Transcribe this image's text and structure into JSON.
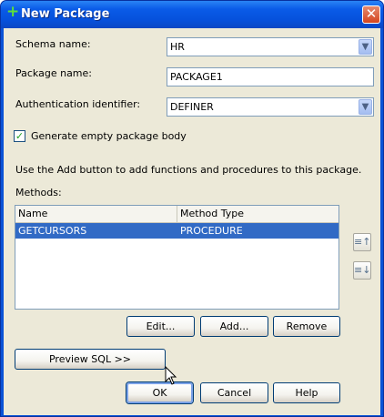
{
  "window": {
    "title": "New Package",
    "close_glyph": "✕"
  },
  "form": {
    "schema_label": "Schema name:",
    "schema_value": "HR",
    "package_label": "Package name:",
    "package_value": "PACKAGE1",
    "auth_label": "Authentication identifier:",
    "auth_value": "DEFINER",
    "generate_label": "Generate empty package body",
    "generate_checked": true,
    "hint": "Use the Add button to add functions and procedures to this package.",
    "methods_label": "Methods:"
  },
  "table": {
    "columns": [
      "Name",
      "Method Type"
    ],
    "rows": [
      {
        "name": "GETCURSORS",
        "type": "PROCEDURE"
      }
    ]
  },
  "buttons": {
    "edit": "Edit...",
    "add": "Add...",
    "remove": "Remove",
    "preview": "Preview SQL >>",
    "ok": "OK",
    "cancel": "Cancel",
    "help": "Help"
  },
  "icons": {
    "title": "plus-icon",
    "move_up": "move-up-icon",
    "move_down": "move-down-icon",
    "cursor": "mouse-pointer-icon"
  },
  "colors": {
    "title_bar": "#0a5be8",
    "selection": "#316ac5",
    "dialog_bg": "#ece9d8"
  }
}
